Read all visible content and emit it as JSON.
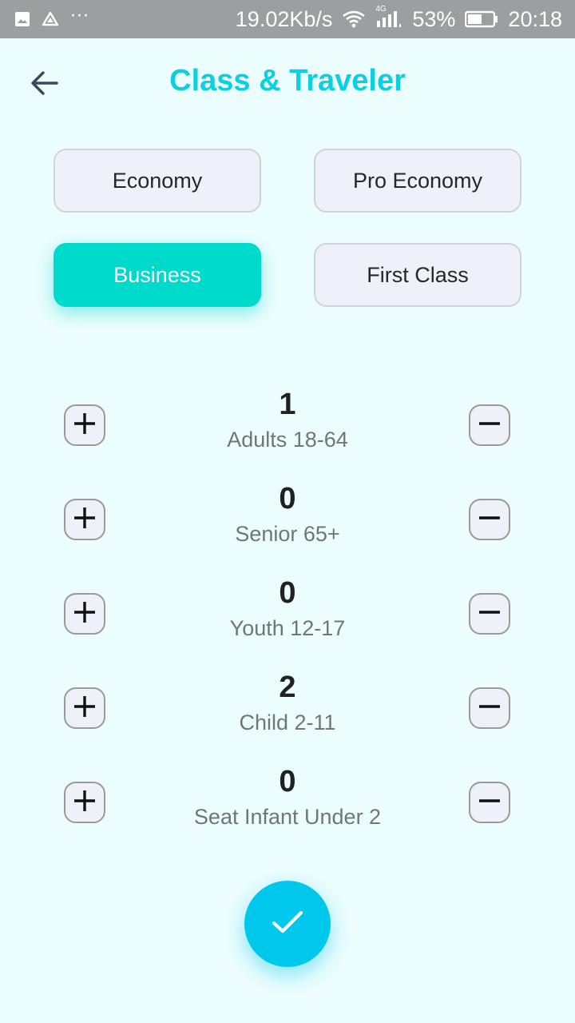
{
  "status_bar": {
    "speed": "19.02Kb/s",
    "network": "4G",
    "battery": "53%",
    "time": "20:18",
    "icons": [
      "image-icon",
      "drive-icon",
      "more-dots-icon",
      "wifi-icon",
      "signal-icon",
      "battery-icon"
    ]
  },
  "header": {
    "title": "Class & Traveler",
    "back_icon": "arrow-left-icon"
  },
  "colors": {
    "accent": "#0ccfe0",
    "selected_class": "#00dacc",
    "confirm": "#00c8ec",
    "background": "#ecfdfe"
  },
  "classes": [
    {
      "label": "Economy",
      "selected": false
    },
    {
      "label": "Pro Economy",
      "selected": false
    },
    {
      "label": "Business",
      "selected": true
    },
    {
      "label": "First Class",
      "selected": false
    }
  ],
  "travelers": [
    {
      "count": "1",
      "label": "Adults 18-64"
    },
    {
      "count": "0",
      "label": "Senior 65+"
    },
    {
      "count": "0",
      "label": "Youth 12-17"
    },
    {
      "count": "2",
      "label": "Child 2-11"
    },
    {
      "count": "0",
      "label": "Seat Infant Under 2"
    }
  ],
  "confirm": {
    "icon": "check-icon"
  }
}
